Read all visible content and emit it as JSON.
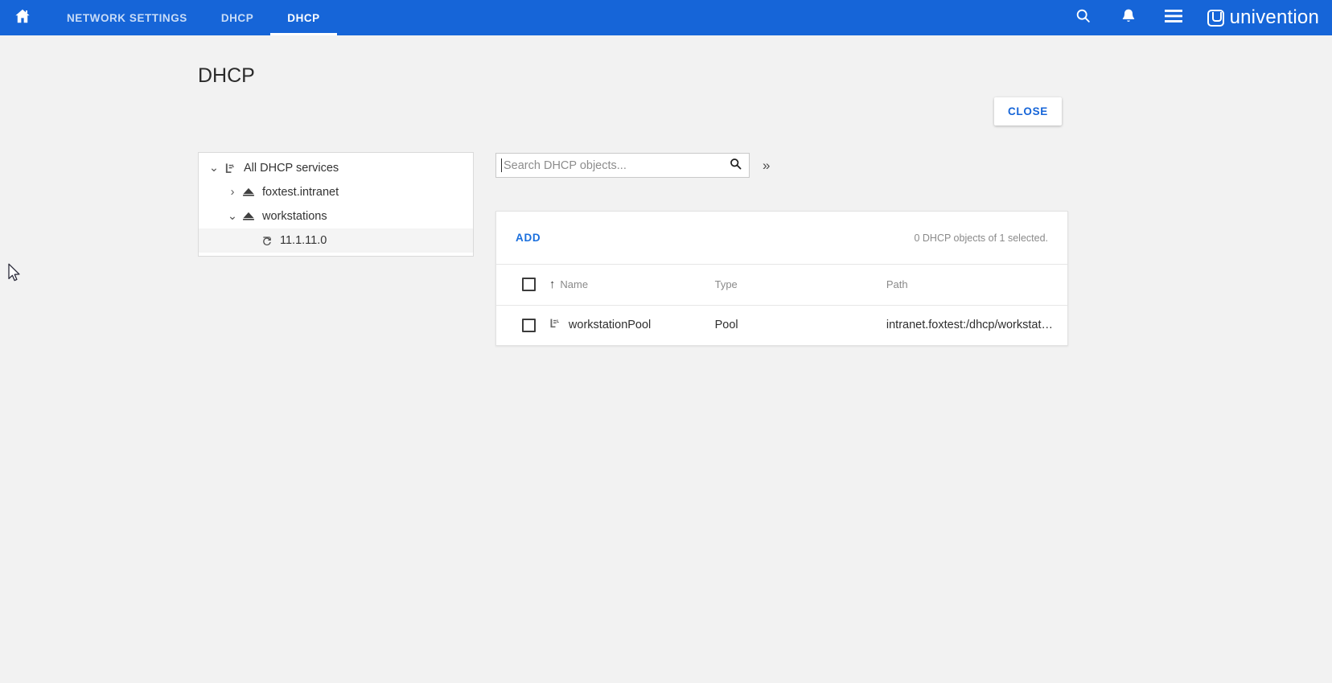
{
  "topbar": {
    "home_icon": "home-icon",
    "tabs": [
      {
        "label": "NETWORK SETTINGS",
        "active": false
      },
      {
        "label": "DHCP",
        "active": false
      },
      {
        "label": "DHCP",
        "active": true
      }
    ],
    "search_icon": "search-icon",
    "bell_icon": "bell-icon",
    "menu_icon": "hamburger-menu-icon",
    "brand_text": "univention",
    "brand_color": "#1665d8"
  },
  "page": {
    "title": "DHCP",
    "close_label": "CLOSE"
  },
  "tree": {
    "items": [
      {
        "label": "All DHCP services",
        "twisty": "⌄",
        "icon": "dhcp-service-root-icon",
        "level": 1,
        "selected": false
      },
      {
        "label": "foxtest.intranet",
        "twisty": "›",
        "icon": "dhcp-subnet-icon",
        "level": 2,
        "selected": false
      },
      {
        "label": "workstations",
        "twisty": "⌄",
        "icon": "dhcp-subnet-icon",
        "level": 2,
        "selected": false
      },
      {
        "label": "11.1.11.0",
        "twisty": "",
        "icon": "dhcp-subnet-node-icon",
        "level": 3,
        "selected": true
      }
    ]
  },
  "search": {
    "placeholder": "Search DHCP objects...",
    "value": "",
    "search_icon": "search-icon",
    "expand_label": "»"
  },
  "grid": {
    "add_label": "ADD",
    "status": "0 DHCP objects of 1 selected.",
    "columns": [
      "Name",
      "Type",
      "Path"
    ],
    "sort_arrow": "↑",
    "rows": [
      {
        "checked": false,
        "icon": "dhcp-pool-icon",
        "name": "workstationPool",
        "type": "Pool",
        "path": "intranet.foxtest:/dhcp/workstat…"
      }
    ]
  }
}
